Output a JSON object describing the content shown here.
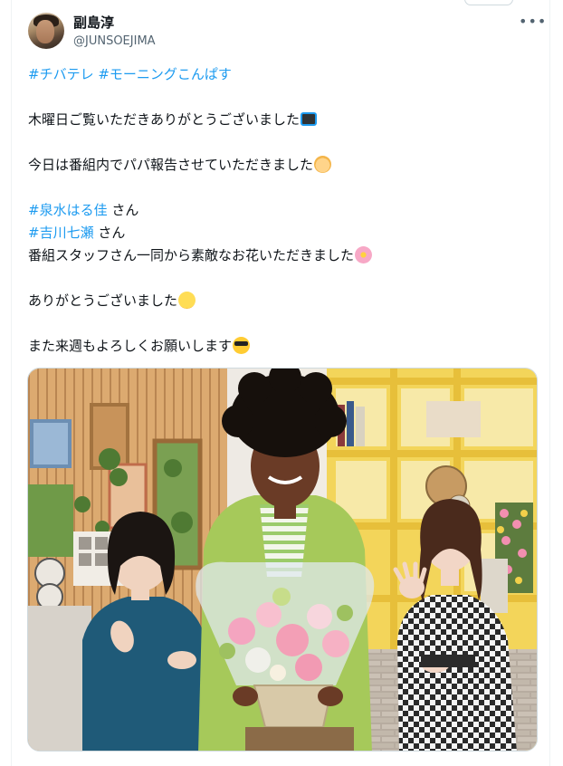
{
  "author": {
    "display_name": "副島淳",
    "handle": "@JUNSOEJIMA",
    "avatar_icon": "user-avatar"
  },
  "menu": {
    "more_icon": "more-horizontal-icon",
    "more_label": "•••"
  },
  "tweet": {
    "hashtags_line": [
      "#チバテレ",
      "#モーニングこんぱす"
    ],
    "line1": "木曜日ご覧いただきありがとうございました",
    "line1_emoji": "television",
    "line2": "今日は番組内でパパ報告させていただきました",
    "line2_emoji": "baby",
    "mention1_tag": "#泉水はる佳",
    "mention1_suffix": " さん",
    "mention2_tag": "#吉川七瀬",
    "mention2_suffix": " さん",
    "line3": "番組スタッフさん一同から素敵なお花いただきました",
    "line3_emoji": "cherry-blossom",
    "line4": "ありがとうございました",
    "line4_emoji": "smiling-face",
    "line5": "また来週もよろしくお願いします",
    "line5_emoji": "sunglasses-face"
  },
  "colors": {
    "link": "#1d9bf0",
    "text": "#0f1419",
    "secondary": "#536471"
  },
  "media": {
    "type": "photo",
    "description_icon": "attached-photo"
  }
}
